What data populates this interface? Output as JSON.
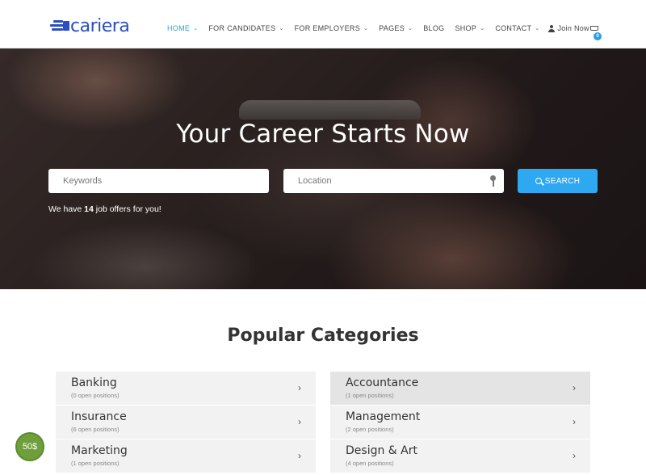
{
  "header": {
    "logo_text": "cariera",
    "nav": [
      {
        "label": "HOME",
        "dropdown": true,
        "active": true
      },
      {
        "label": "FOR CANDIDATES",
        "dropdown": true
      },
      {
        "label": "FOR EMPLOYERS",
        "dropdown": true
      },
      {
        "label": "PAGES",
        "dropdown": true
      },
      {
        "label": "BLOG",
        "dropdown": false
      },
      {
        "label": "SHOP",
        "dropdown": true
      },
      {
        "label": "CONTACT",
        "dropdown": true
      }
    ],
    "join_label": "Join Now",
    "cart_count": "0",
    "chevron": "⌄",
    "accent_color": "#2a9fe3"
  },
  "hero": {
    "title": "Your Career Starts Now",
    "keywords_placeholder": "Keywords",
    "location_placeholder": "Location",
    "search_label": "SEARCH",
    "offers_prefix": "We have ",
    "offers_count": "14",
    "offers_suffix": " job offers for you!",
    "button_color": "#2ea8f0"
  },
  "categories": {
    "title": "Popular Categories",
    "arrow": "›",
    "left": [
      {
        "name": "Banking",
        "count": "(0 open positions)"
      },
      {
        "name": "Insurance",
        "count": "(6 open positions)"
      },
      {
        "name": "Marketing",
        "count": "(1 open positions)"
      }
    ],
    "right": [
      {
        "name": "Accountance",
        "count": "(1 open positions)"
      },
      {
        "name": "Management",
        "count": "(2 open positions)"
      },
      {
        "name": "Design & Art",
        "count": "(4 open positions)"
      }
    ]
  },
  "price_badge": "50$"
}
